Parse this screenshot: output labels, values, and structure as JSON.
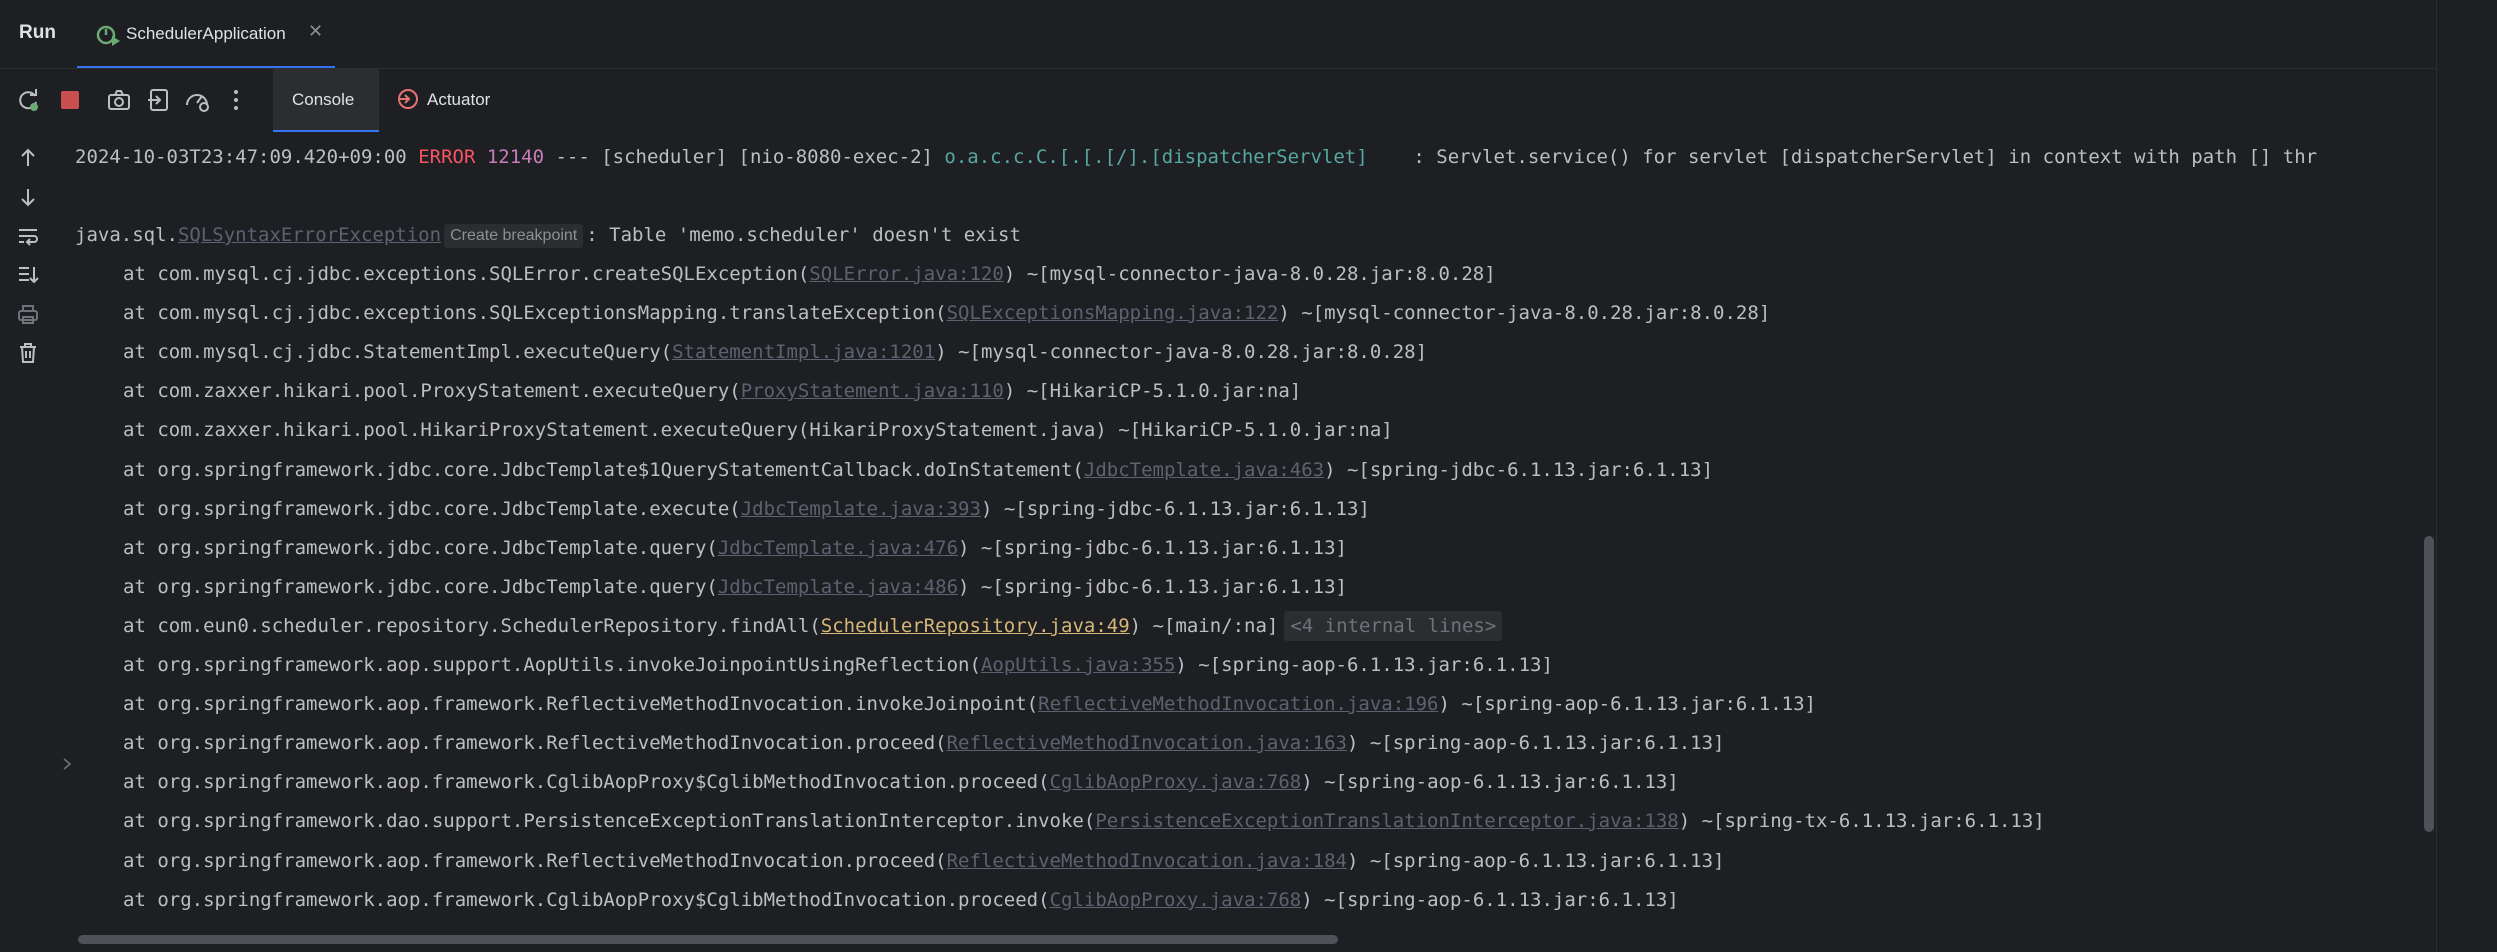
{
  "header": {
    "run_title": "Run",
    "tab_label": "SchedulerApplication",
    "tab_close": "✕"
  },
  "toolbar": {
    "console_tab": "Console",
    "actuator_tab": "Actuator"
  },
  "console": {
    "log_line": {
      "timestamp": "2024-10-03T23:47:09.420+09:00",
      "level": "ERROR",
      "pid": "12140",
      "separator": " --- [scheduler] [nio-8080-exec-2] ",
      "logger": "o.a.c.c.C.[.[.[/].[dispatcherServlet]",
      "message": "    : Servlet.service() for servlet [dispatcherServlet] in context with path [] thr"
    },
    "exception": {
      "prefix": "java.sql.",
      "class_link": "SQLSyntaxErrorException",
      "breakpoint_chip": "Create breakpoint",
      "message": ": Table 'memo.scheduler' doesn't exist"
    },
    "frames": [
      {
        "pre": "at com.mysql.cj.jdbc.exceptions.SQLError.createSQLException(",
        "link": "SQLError.java:120",
        "post": ") ~[mysql-connector-java-8.0.28.jar:8.0.28]"
      },
      {
        "pre": "at com.mysql.cj.jdbc.exceptions.SQLExceptionsMapping.translateException(",
        "link": "SQLExceptionsMapping.java:122",
        "post": ") ~[mysql-connector-java-8.0.28.jar:8.0.28]"
      },
      {
        "pre": "at com.mysql.cj.jdbc.StatementImpl.executeQuery(",
        "link": "StatementImpl.java:1201",
        "post": ") ~[mysql-connector-java-8.0.28.jar:8.0.28]"
      },
      {
        "pre": "at com.zaxxer.hikari.pool.ProxyStatement.executeQuery(",
        "link": "ProxyStatement.java:110",
        "post": ") ~[HikariCP-5.1.0.jar:na]"
      },
      {
        "pre": "at com.zaxxer.hikari.pool.HikariProxyStatement.executeQuery(HikariProxyStatement.java) ~[HikariCP-5.1.0.jar:na]",
        "link": "",
        "post": ""
      },
      {
        "pre": "at org.springframework.jdbc.core.JdbcTemplate$1QueryStatementCallback.doInStatement(",
        "link": "JdbcTemplate.java:463",
        "post": ") ~[spring-jdbc-6.1.13.jar:6.1.13]"
      },
      {
        "pre": "at org.springframework.jdbc.core.JdbcTemplate.execute(",
        "link": "JdbcTemplate.java:393",
        "post": ") ~[spring-jdbc-6.1.13.jar:6.1.13]"
      },
      {
        "pre": "at org.springframework.jdbc.core.JdbcTemplate.query(",
        "link": "JdbcTemplate.java:476",
        "post": ") ~[spring-jdbc-6.1.13.jar:6.1.13]"
      },
      {
        "pre": "at org.springframework.jdbc.core.JdbcTemplate.query(",
        "link": "JdbcTemplate.java:486",
        "post": ") ~[spring-jdbc-6.1.13.jar:6.1.13]"
      },
      {
        "pre": "at com.eun0.scheduler.repository.SchedulerRepository.findAll(",
        "link": "SchedulerRepository.java:49",
        "post": ") ~[main/:na]",
        "internal": "<4 internal lines>",
        "user_code": true
      },
      {
        "pre": "at org.springframework.aop.support.AopUtils.invokeJoinpointUsingReflection(",
        "link": "AopUtils.java:355",
        "post": ") ~[spring-aop-6.1.13.jar:6.1.13]"
      },
      {
        "pre": "at org.springframework.aop.framework.ReflectiveMethodInvocation.invokeJoinpoint(",
        "link": "ReflectiveMethodInvocation.java:196",
        "post": ") ~[spring-aop-6.1.13.jar:6.1.13]"
      },
      {
        "pre": "at org.springframework.aop.framework.ReflectiveMethodInvocation.proceed(",
        "link": "ReflectiveMethodInvocation.java:163",
        "post": ") ~[spring-aop-6.1.13.jar:6.1.13]"
      },
      {
        "pre": "at org.springframework.aop.framework.CglibAopProxy$CglibMethodInvocation.proceed(",
        "link": "CglibAopProxy.java:768",
        "post": ") ~[spring-aop-6.1.13.jar:6.1.13]"
      },
      {
        "pre": "at org.springframework.dao.support.PersistenceExceptionTranslationInterceptor.invoke(",
        "link": "PersistenceExceptionTranslationInterceptor.java:138",
        "post": ") ~[spring-tx-6.1.13.jar:6.1.13]"
      },
      {
        "pre": "at org.springframework.aop.framework.ReflectiveMethodInvocation.proceed(",
        "link": "ReflectiveMethodInvocation.java:184",
        "post": ") ~[spring-aop-6.1.13.jar:6.1.13]"
      },
      {
        "pre": "at org.springframework.aop.framework.CglibAopProxy$CglibMethodInvocation.proceed(",
        "link": "CglibAopProxy.java:768",
        "post": ") ~[spring-aop-6.1.13.jar:6.1.13]"
      }
    ]
  },
  "colors": {
    "background": "#1e1f22",
    "accent": "#3574f0",
    "error": "#f75464",
    "link": "#5c6370",
    "user_link": "#d5b778",
    "stop": "#c94f4f"
  },
  "icons": {
    "toolbar": [
      "rerun-icon",
      "stop-icon",
      "camera-icon",
      "exit-icon",
      "profiler-icon",
      "more-icon"
    ],
    "sidebar": [
      "arrow-up-icon",
      "arrow-down-icon",
      "soft-wrap-icon",
      "scroll-to-end-icon",
      "print-icon",
      "trash-icon"
    ]
  }
}
